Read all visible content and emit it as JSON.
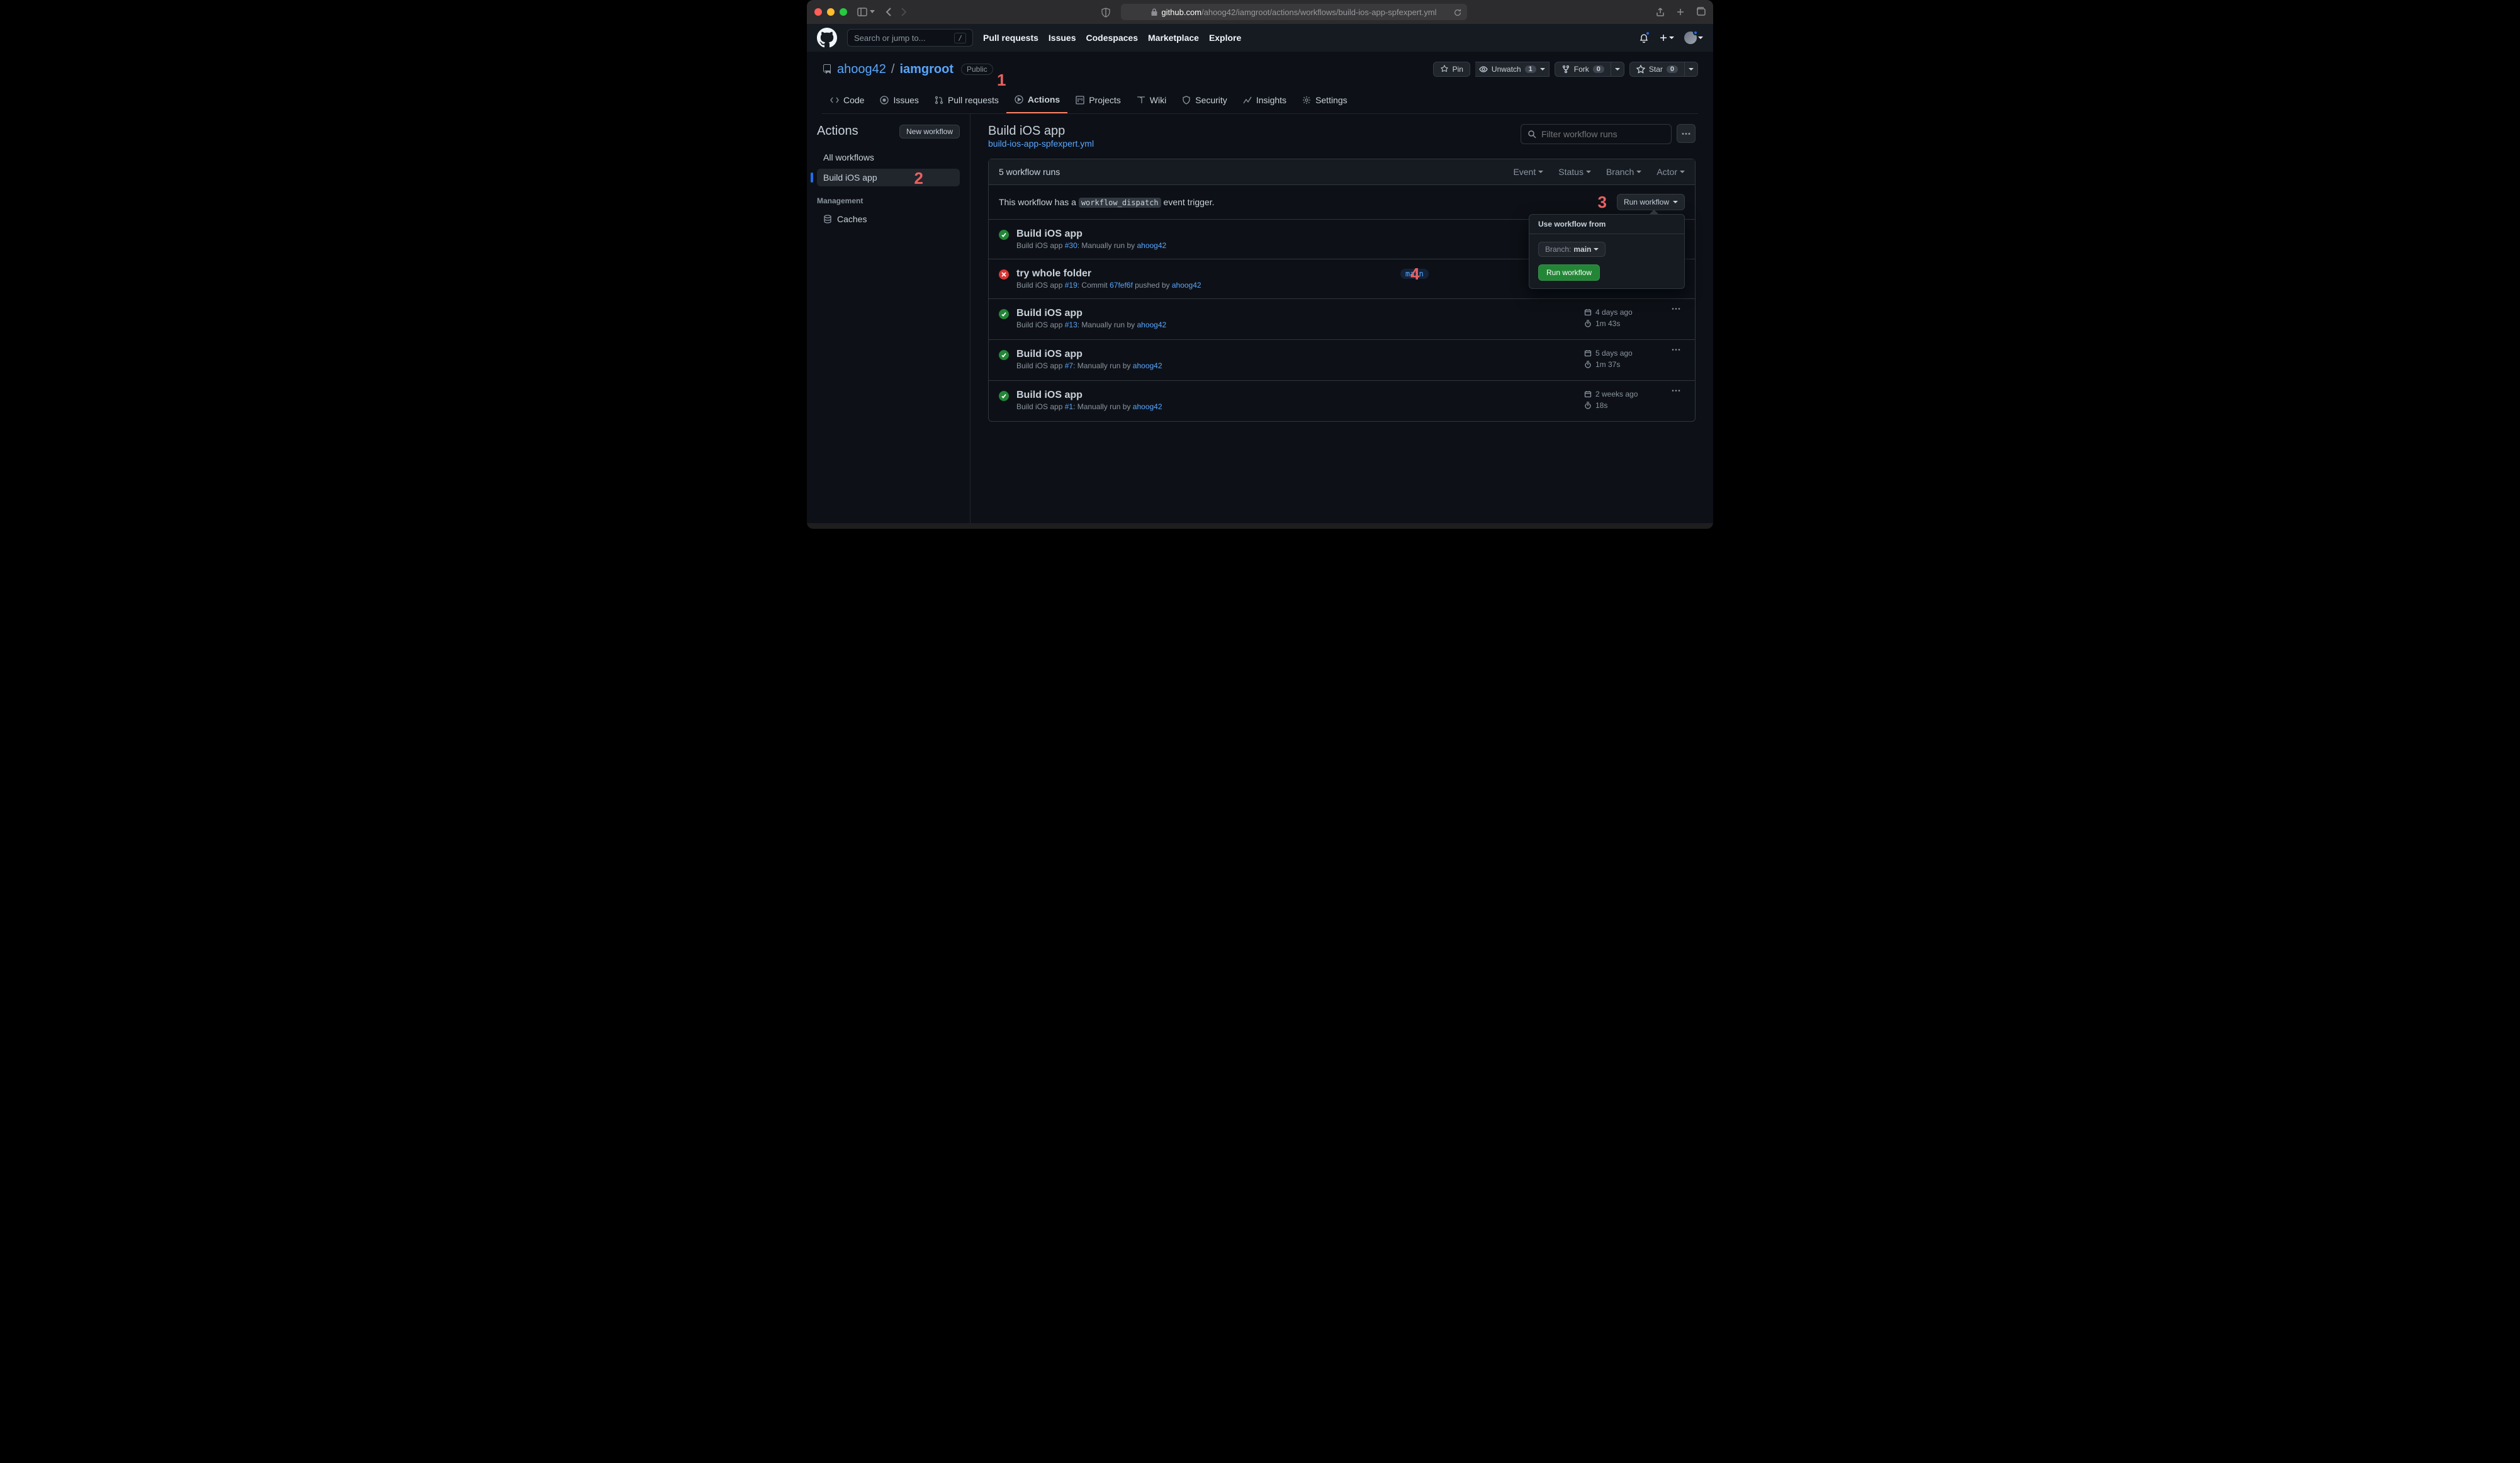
{
  "browser": {
    "url_host": "github.com",
    "url_path": "/ahoog42/iamgroot/actions/workflows/build-ios-app-spfexpert.yml"
  },
  "gh_header": {
    "search_placeholder": "Search or jump to...",
    "search_key": "/",
    "nav": {
      "pull_requests": "Pull requests",
      "issues": "Issues",
      "codespaces": "Codespaces",
      "marketplace": "Marketplace",
      "explore": "Explore"
    }
  },
  "repo": {
    "owner": "ahoog42",
    "sep": "/",
    "name": "iamgroot",
    "visibility": "Public",
    "actions": {
      "pin": "Pin",
      "unwatch": "Unwatch",
      "watch_count": "1",
      "fork": "Fork",
      "fork_count": "0",
      "star": "Star",
      "star_count": "0"
    }
  },
  "repo_nav": {
    "code": "Code",
    "issues": "Issues",
    "pulls": "Pull requests",
    "actions": "Actions",
    "projects": "Projects",
    "wiki": "Wiki",
    "security": "Security",
    "insights": "Insights",
    "settings": "Settings"
  },
  "sidebar": {
    "title": "Actions",
    "new_btn": "New workflow",
    "all_workflows": "All workflows",
    "build_ios": "Build iOS app",
    "management": "Management",
    "caches": "Caches"
  },
  "content": {
    "title": "Build iOS app",
    "file": "build-ios-app-spfexpert.yml",
    "filter_placeholder": "Filter workflow runs"
  },
  "runs": {
    "count_label": "5 workflow runs",
    "filters": {
      "event": "Event",
      "status": "Status",
      "branch": "Branch",
      "actor": "Actor"
    },
    "dispatch_prefix": "This workflow has a ",
    "dispatch_code": "workflow_dispatch",
    "dispatch_suffix": " event trigger.",
    "run_wf_btn": "Run workflow",
    "popover": {
      "header": "Use workflow from",
      "branch_label": "Branch:",
      "branch_name": "main",
      "run_btn": "Run workflow"
    },
    "rows": [
      {
        "status": "success",
        "title": "Build iOS app",
        "sub_prefix": "Build iOS app ",
        "sub_num": "#30",
        "sub_mid": ": Manually run by ",
        "sub_actor": "ahoog42",
        "branch": "",
        "date": "",
        "duration": ""
      },
      {
        "status": "failure",
        "title": "try whole folder",
        "sub_prefix": "Build iOS app ",
        "sub_num": "#19",
        "sub_mid": ": Commit ",
        "sub_commit": "67fef6f",
        "sub_push": " pushed by ",
        "sub_actor": "ahoog42",
        "branch": "main",
        "failure_label": "Failure"
      },
      {
        "status": "success",
        "title": "Build iOS app",
        "sub_prefix": "Build iOS app ",
        "sub_num": "#13",
        "sub_mid": ": Manually run by ",
        "sub_actor": "ahoog42",
        "date": "4 days ago",
        "duration": "1m 43s"
      },
      {
        "status": "success",
        "title": "Build iOS app",
        "sub_prefix": "Build iOS app ",
        "sub_num": "#7",
        "sub_mid": ": Manually run by ",
        "sub_actor": "ahoog42",
        "date": "5 days ago",
        "duration": "1m 37s"
      },
      {
        "status": "success",
        "title": "Build iOS app",
        "sub_prefix": "Build iOS app ",
        "sub_num": "#1",
        "sub_mid": ": Manually run by ",
        "sub_actor": "ahoog42",
        "date": "2 weeks ago",
        "duration": "18s"
      }
    ]
  },
  "annotations": {
    "a1": "1",
    "a2": "2",
    "a3": "3",
    "a4": "4"
  }
}
